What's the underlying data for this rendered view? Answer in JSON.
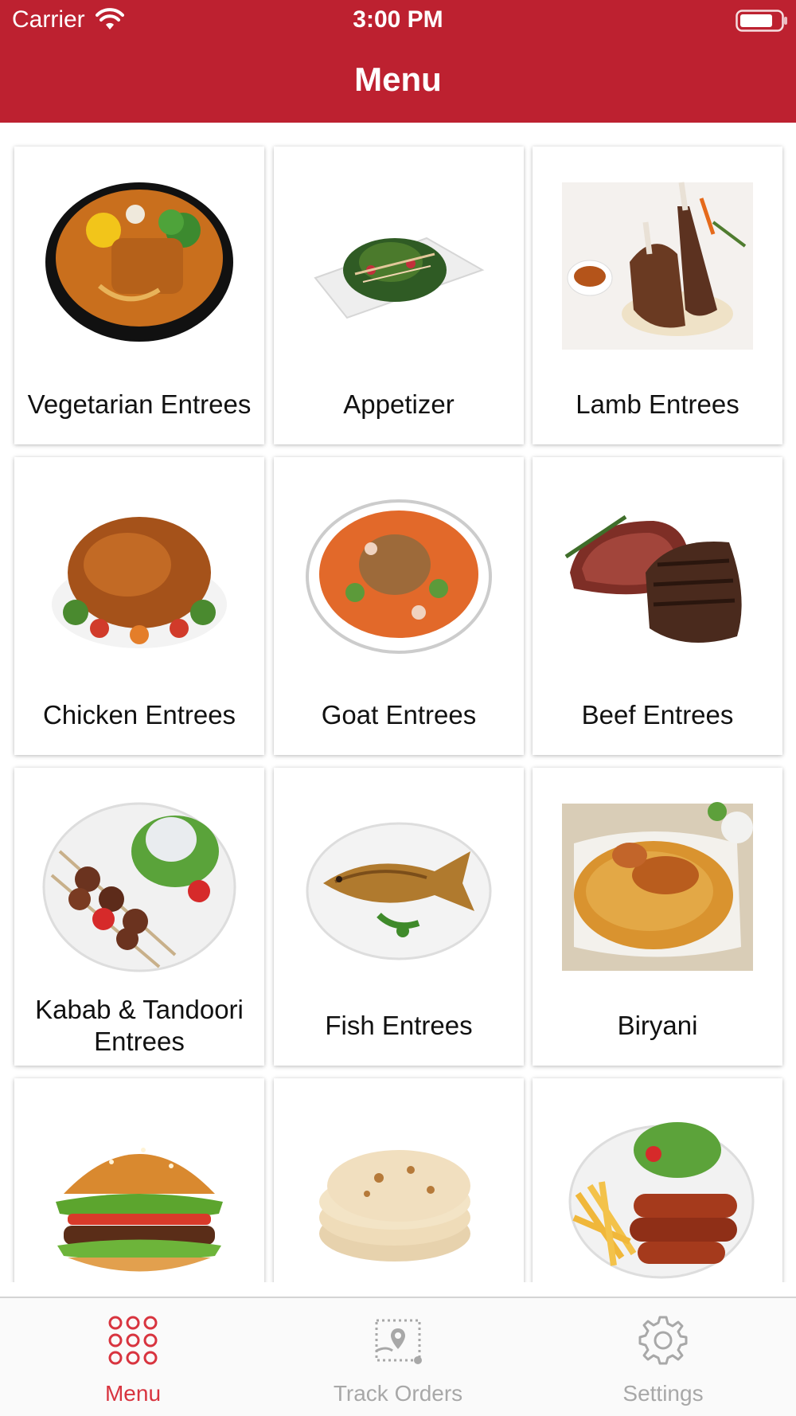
{
  "status_bar": {
    "carrier": "Carrier",
    "time": "3:00 PM",
    "wifi_icon": "wifi-icon",
    "battery_icon": "battery-icon"
  },
  "header": {
    "title": "Menu",
    "background_color": "#bd2130"
  },
  "categories": [
    {
      "label": "Vegetarian Entrees",
      "image": "vegetarian-entrees-image"
    },
    {
      "label": "Appetizer",
      "image": "appetizer-image"
    },
    {
      "label": "Lamb Entrees",
      "image": "lamb-entrees-image"
    },
    {
      "label": "Chicken Entrees",
      "image": "chicken-entrees-image"
    },
    {
      "label": "Goat Entrees",
      "image": "goat-entrees-image"
    },
    {
      "label": "Beef Entrees",
      "image": "beef-entrees-image"
    },
    {
      "label": "Kabab & Tandoori Entrees",
      "image": "kabab-tandoori-entrees-image"
    },
    {
      "label": "Fish Entrees",
      "image": "fish-entrees-image"
    },
    {
      "label": "Biryani",
      "image": "biryani-image"
    },
    {
      "label": "",
      "image": "burger-image"
    },
    {
      "label": "",
      "image": "naan-bread-image"
    },
    {
      "label": "",
      "image": "sausage-fries-image"
    }
  ],
  "tab_bar": {
    "active_color": "#d8343f",
    "inactive_color": "#a8a8a8",
    "tabs": [
      {
        "label": "Menu",
        "icon": "menu-grid-icon",
        "active": true
      },
      {
        "label": "Track Orders",
        "icon": "track-orders-icon",
        "active": false
      },
      {
        "label": "Settings",
        "icon": "gear-icon",
        "active": false
      }
    ]
  }
}
